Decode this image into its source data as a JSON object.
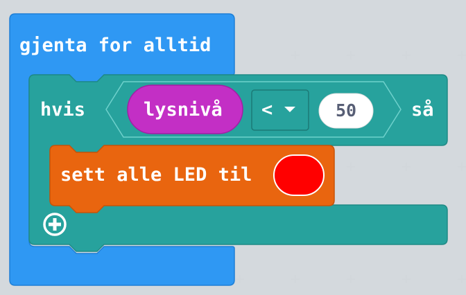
{
  "blocks": {
    "forever": {
      "label": "gjenta for alltid",
      "color": "#2f98f3"
    },
    "if_block": {
      "if_label": "hvis",
      "then_label": "så",
      "color": "#27a29d",
      "condition": {
        "operator": "<",
        "left_reporter": {
          "label": "lysnivå",
          "color": "#c32fc5"
        },
        "right_value": "50"
      },
      "add_else_icon": "plus-circle-icon"
    },
    "set_leds": {
      "label": "sett alle LED til",
      "color": "#e9650f",
      "swatch_color": "#ff0000"
    }
  },
  "icons": {
    "dropdown": "triangle-down-icon",
    "add": "plus-circle-icon"
  }
}
